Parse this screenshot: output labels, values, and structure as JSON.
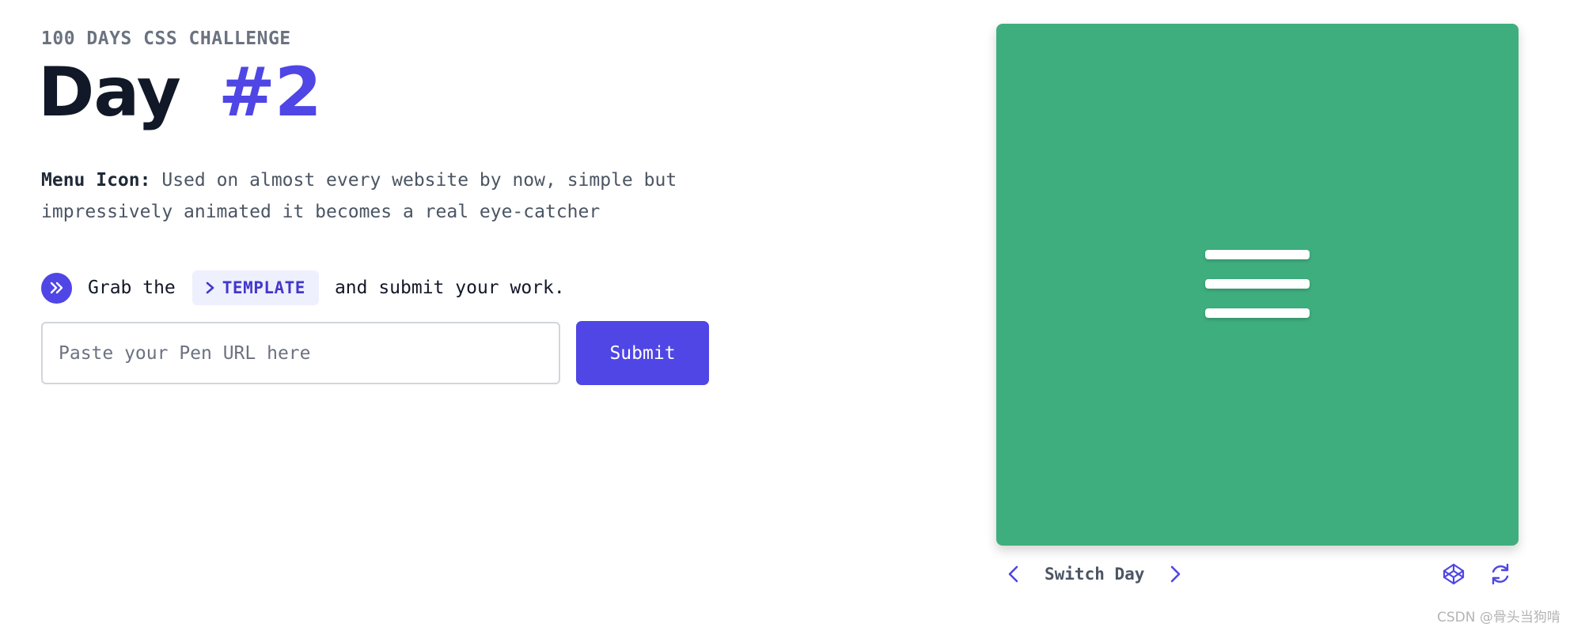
{
  "header": {
    "eyebrow": "100 DAYS CSS CHALLENGE",
    "title_word": "Day",
    "title_number": "#2"
  },
  "description": {
    "label": "Menu Icon:",
    "text": "Used on almost every website by now, simple but impressively animated it becomes a real eye-catcher"
  },
  "grab_row": {
    "icon": "double-chevron-right-icon",
    "prefix": "Grab the",
    "template_label": "TEMPLATE",
    "template_icon": "chevron-right-icon",
    "suffix": "and submit your work."
  },
  "submission": {
    "placeholder": "Paste your Pen URL here",
    "value": "",
    "submit_label": "Submit"
  },
  "preview": {
    "background_color": "#3fae7e",
    "content_icon": "hamburger-menu-icon"
  },
  "switcher": {
    "label": "Switch Day",
    "prev_icon": "chevron-left-icon",
    "next_icon": "chevron-right-icon",
    "codepen_icon": "codepen-icon",
    "reload_icon": "reload-icon"
  },
  "watermark": "CSDN @骨头当狗啃",
  "colors": {
    "accent": "#4f46e5",
    "heading": "#111827",
    "muted": "#6b7280",
    "template_bg": "#eef0fe"
  }
}
